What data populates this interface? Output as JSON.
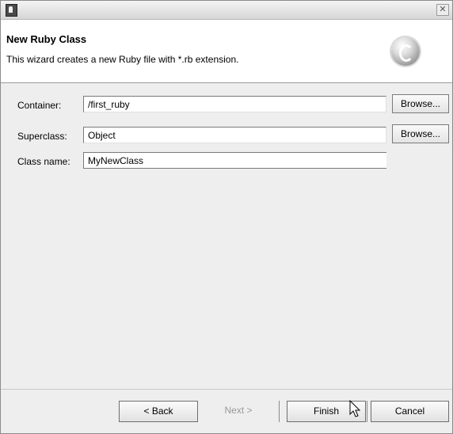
{
  "window": {
    "close_glyph": "✕"
  },
  "wizard": {
    "title": "New Ruby Class",
    "description": "This wizard creates a new Ruby file with *.rb extension.",
    "icon": "ruby-class-c-icon"
  },
  "form": {
    "container_label": "Container:",
    "container_value": "/first_ruby",
    "superclass_label": "Superclass:",
    "superclass_value": "Object",
    "classname_label": "Class name:",
    "classname_value": "MyNewClass",
    "browse_label": "Browse..."
  },
  "buttons": {
    "back": "< Back",
    "next": "Next >",
    "finish": "Finish",
    "cancel": "Cancel",
    "next_enabled": false
  },
  "colors": {
    "header_bg": "#ffffff",
    "body_bg": "#eeeeee"
  }
}
